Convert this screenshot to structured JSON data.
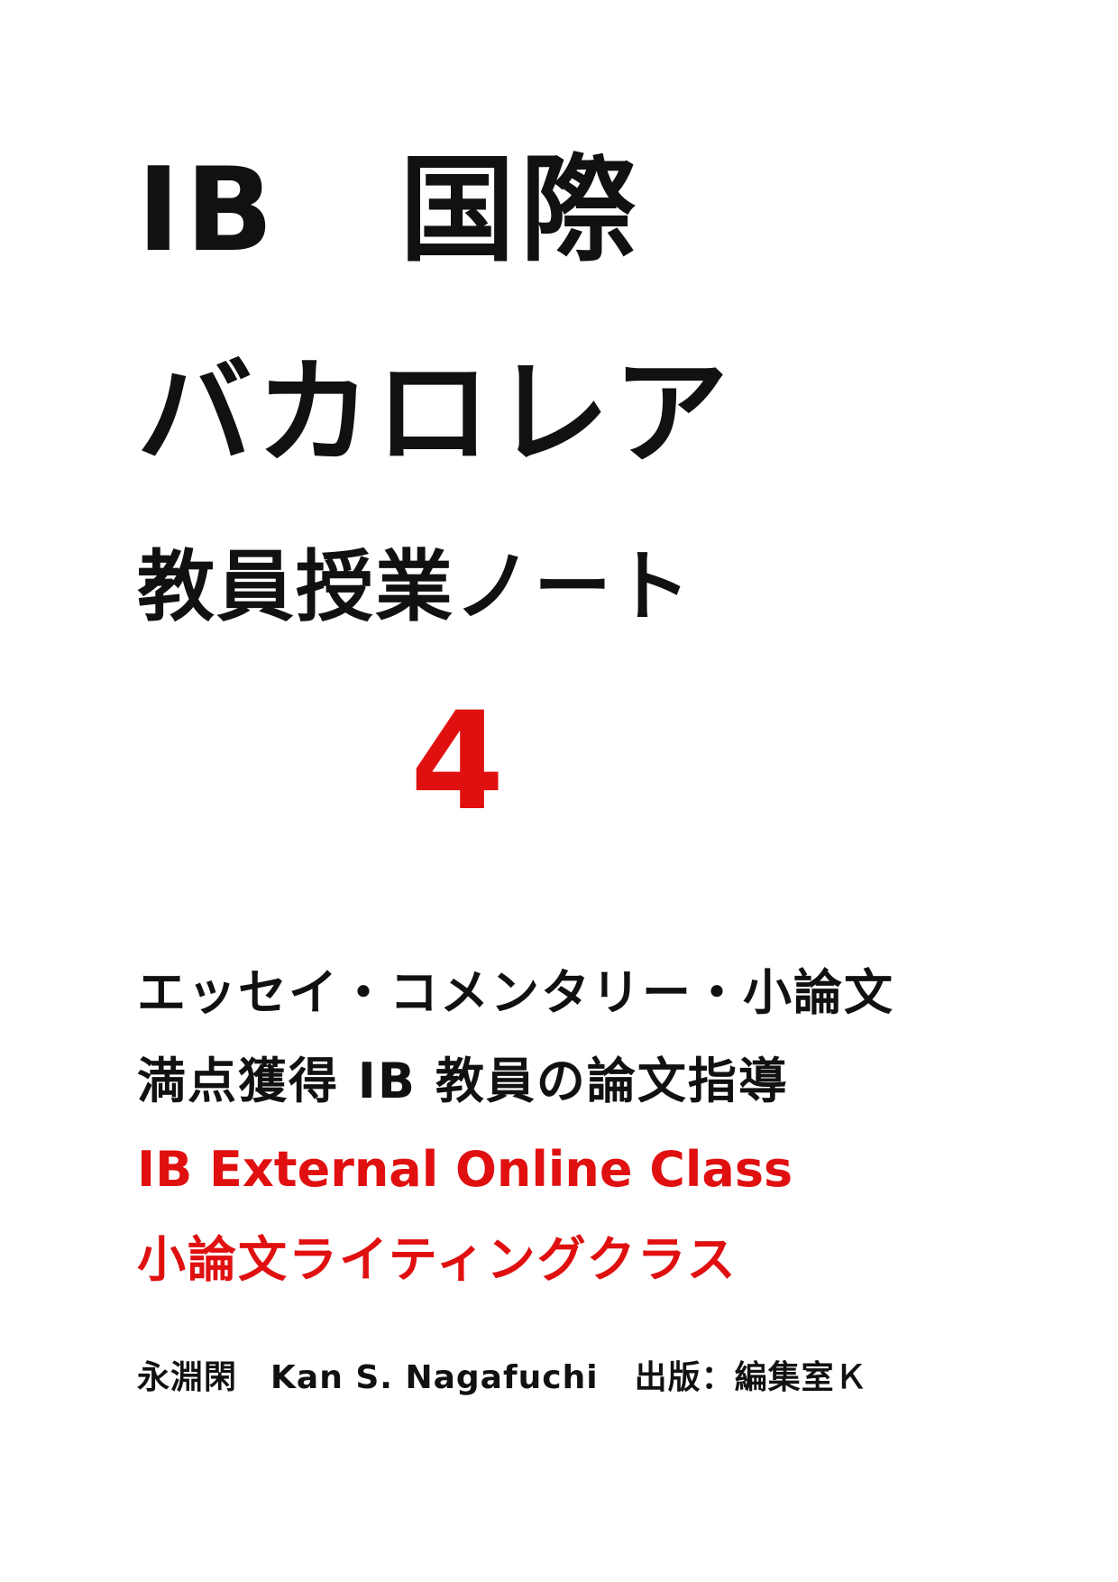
{
  "cover": {
    "title_line1": "IB　国際",
    "title_line2": "バカロレア",
    "title_line3": "教員授業ノート",
    "volume": "4",
    "subtitle_line1": "エッセイ・コメンタリー・小論文",
    "subtitle_line2": "満点獲得 IB 教員の論文指導",
    "subtitle_line3": "IB External Online Class",
    "subtitle_line4": "小論文ライティングクラス",
    "author": "永淵閑　Kan S. Nagafuchi",
    "publisher": "出版：編集室Ｋ"
  },
  "colors": {
    "text": "#111111",
    "accent": "#e01010",
    "background": "#ffffff"
  }
}
